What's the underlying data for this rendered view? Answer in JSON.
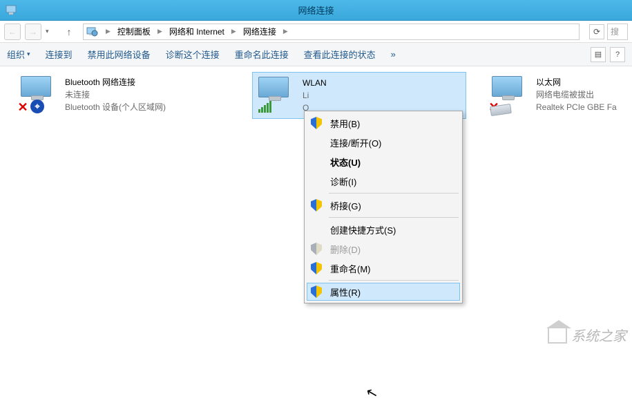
{
  "window": {
    "title": "网络连接"
  },
  "breadcrumb": {
    "items": [
      "控制面板",
      "网络和 Internet",
      "网络连接"
    ]
  },
  "search": {
    "placeholder": "搜"
  },
  "toolbar": {
    "organize": "组织",
    "connect": "连接到",
    "disable": "禁用此网络设备",
    "diagnose": "诊断这个连接",
    "rename": "重命名此连接",
    "view_status": "查看此连接的状态",
    "more": "»"
  },
  "connections": [
    {
      "name": "Bluetooth 网络连接",
      "status": "未连接",
      "device": "Bluetooth 设备(个人区域网)"
    },
    {
      "name": "WLAN",
      "status": "Li",
      "device": "Q"
    },
    {
      "name": "以太网",
      "status": "网络电缆被拔出",
      "device": "Realtek PCIe GBE Fa"
    }
  ],
  "context_menu": {
    "disable": "禁用(B)",
    "connect_disconnect": "连接/断开(O)",
    "status": "状态(U)",
    "diagnose": "诊断(I)",
    "bridge": "桥接(G)",
    "shortcut": "创建快捷方式(S)",
    "delete": "删除(D)",
    "rename": "重命名(M)",
    "properties": "属性(R)"
  },
  "watermark": "系统之家"
}
